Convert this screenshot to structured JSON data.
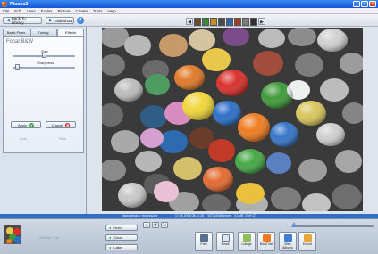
{
  "window": {
    "title": "Picasa3",
    "minimize": "_",
    "maximize": "□",
    "close": "×"
  },
  "menu": [
    "File",
    "Edit",
    "View",
    "Folder",
    "Picture",
    "Create",
    "Tools",
    "Help"
  ],
  "toolbar": {
    "back_label": "Back To Library",
    "slideshow_label": "Slideshow",
    "help": "?",
    "prev": "◀",
    "next": "▶",
    "thumbnails": [
      "#6b4a2e",
      "#3d8a3a",
      "#c78d2d",
      "#4a4a4a",
      "#2e6aa6",
      "#a33a2a",
      "#7c7c7c",
      "#2f2f2f"
    ]
  },
  "left_panel": {
    "tabs": [
      "Basic Fixes",
      "Tuning",
      "Effects"
    ],
    "active_tab": "Effects",
    "effect_title": "Focal B&W",
    "sliders": [
      {
        "label": "Size",
        "value": 0.5
      },
      {
        "label": "Sharpness",
        "value": 0.05
      }
    ],
    "apply_label": "Apply",
    "cancel_label": "Cancel",
    "apply_icon": "✔",
    "cancel_icon": "✖",
    "under_left": "Undo",
    "under_right": "Redo"
  },
  "status": {
    "filename": "Macrophoto > rzeczka.jpg",
    "date": "17.09.2008 08:41:29",
    "dimensions": "3072x2048 pixels",
    "size": "3.1MB",
    "position": "(1 of 17)"
  },
  "tray": {
    "placeholder": "Selection Tray",
    "hold_label": "Hold",
    "clear_label": "Clear",
    "label_label": "Label",
    "actions": [
      {
        "label": "Print",
        "color": "#5a6f8f"
      },
      {
        "label": "Email",
        "color": "#d8e6f3"
      },
      {
        "label": "Collage",
        "color": "#8fbf5a"
      },
      {
        "label": "BlogThis!",
        "color": "#f07a22"
      },
      {
        "label": "Web Albums",
        "color": "#3f7ed6"
      },
      {
        "label": "Export",
        "color": "#e7a63a"
      }
    ]
  }
}
